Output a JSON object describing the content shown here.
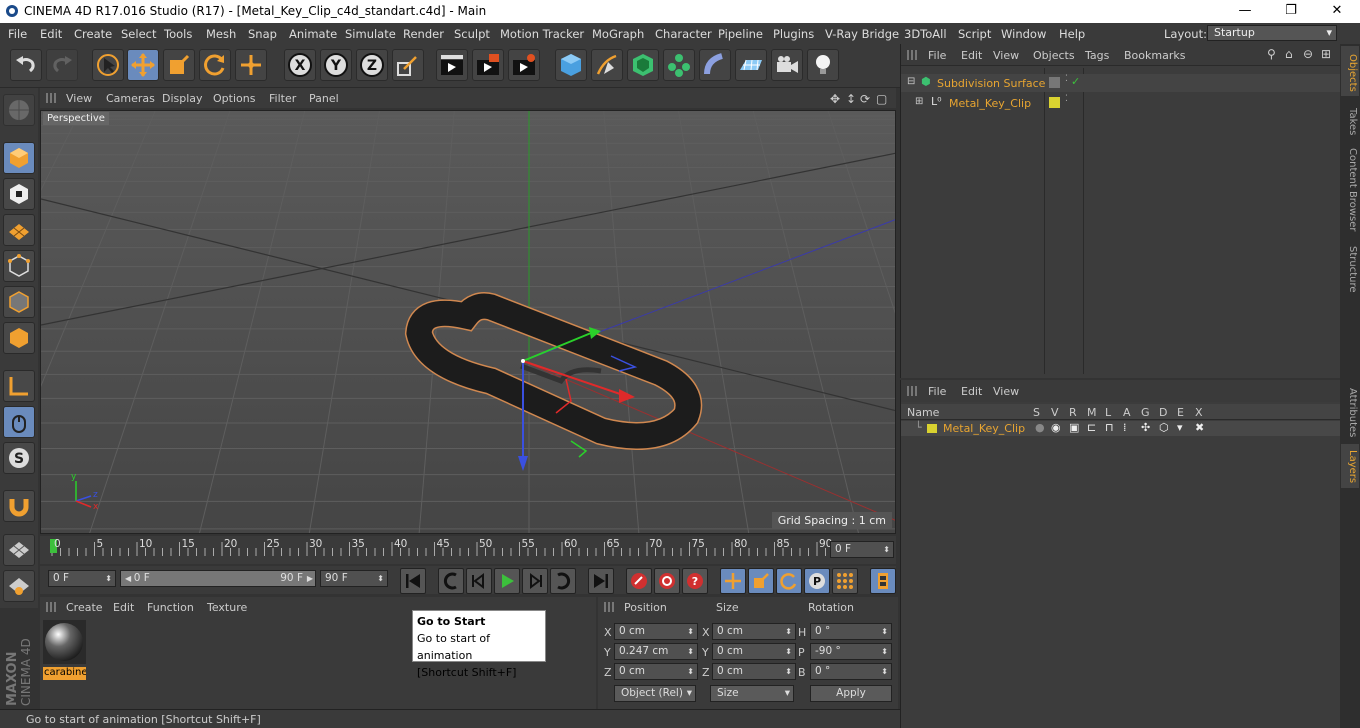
{
  "window": {
    "title": "CINEMA 4D R17.016 Studio (R17) - [Metal_Key_Clip_c4d_standart.c4d] - Main"
  },
  "menu": {
    "items": [
      "File",
      "Edit",
      "Create",
      "Select",
      "Tools",
      "Mesh",
      "Snap",
      "Animate",
      "Simulate",
      "Render",
      "Sculpt",
      "Motion Tracker",
      "MoGraph",
      "Character",
      "Pipeline",
      "Plugins",
      "V-Ray Bridge",
      "3DToAll",
      "Script",
      "Window",
      "Help"
    ],
    "layout_label": "Layout:",
    "layout_value": "Startup"
  },
  "viewport": {
    "menu": [
      "View",
      "Cameras",
      "Display",
      "Options",
      "Filter",
      "Panel"
    ],
    "camera": "Perspective",
    "grid_spacing": "Grid Spacing : 1 cm"
  },
  "timeline": {
    "ticks": [
      "0",
      "5",
      "10",
      "15",
      "20",
      "25",
      "30",
      "35",
      "40",
      "45",
      "50",
      "55",
      "60",
      "65",
      "70",
      "75",
      "80",
      "85",
      "90"
    ],
    "current_frame": "0 F",
    "start": "0 F",
    "range_start": "0 F",
    "range_end": "90 F",
    "end": "90 F"
  },
  "materials": {
    "menu": [
      "Create",
      "Edit",
      "Function",
      "Texture"
    ],
    "material_name": "carabine"
  },
  "coords": {
    "headers": [
      "Position",
      "Size",
      "Rotation"
    ],
    "pos": {
      "x": "0 cm",
      "y": "0.247 cm",
      "z": "0 cm"
    },
    "size": {
      "x": "0 cm",
      "y": "0 cm",
      "z": "0 cm"
    },
    "rot": {
      "h": "0 °",
      "p": "-90 °",
      "b": "0 °"
    },
    "axes": [
      "X",
      "Y",
      "Z"
    ],
    "rot_axes": [
      "H",
      "P",
      "B"
    ],
    "mode": "Object (Rel)",
    "size_mode": "Size",
    "apply": "Apply"
  },
  "tooltip": {
    "title": "Go to Start",
    "desc": "Go to start of animation",
    "shortcut": "[Shortcut Shift+F]"
  },
  "status": "Go to start of animation [Shortcut Shift+F]",
  "objects": {
    "menu": [
      "File",
      "Edit",
      "View",
      "Objects",
      "Tags",
      "Bookmarks"
    ],
    "items": [
      "Subdivision Surface",
      "Metal_Key_Clip"
    ]
  },
  "layers": {
    "menu": [
      "File",
      "Edit",
      "View"
    ],
    "cols": [
      "Name",
      "S",
      "V",
      "R",
      "M",
      "L",
      "A",
      "G",
      "D",
      "E",
      "X"
    ],
    "row": "Metal_Key_Clip"
  },
  "side_tabs": [
    "Objects",
    "Takes",
    "Content Browser",
    "Structure",
    "Attributes",
    "Layers"
  ],
  "brand": [
    "MAXON",
    "CINEMA 4D"
  ],
  "colors": {
    "accent": "#6a8bbd",
    "object_text": "#e8a531",
    "layer_yellow": "#d9d230"
  }
}
